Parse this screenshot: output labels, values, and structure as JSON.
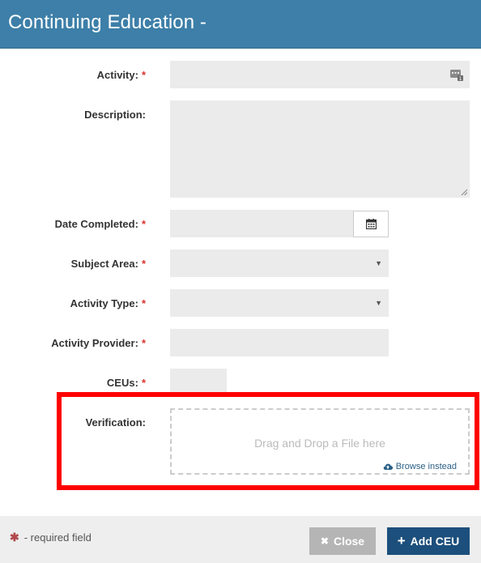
{
  "header": {
    "title": "Continuing Education -"
  },
  "form": {
    "activity": {
      "label": "Activity:",
      "required": "*",
      "value": ""
    },
    "description": {
      "label": "Description:",
      "value": ""
    },
    "date_completed": {
      "label": "Date Completed:",
      "required": "*",
      "value": ""
    },
    "subject_area": {
      "label": "Subject Area:",
      "required": "*",
      "selected": ""
    },
    "activity_type": {
      "label": "Activity Type:",
      "required": "*",
      "selected": ""
    },
    "activity_provider": {
      "label": "Activity Provider:",
      "required": "*",
      "value": ""
    },
    "ceus": {
      "label": "CEUs:",
      "required": "*",
      "value": ""
    },
    "verification": {
      "label": "Verification:",
      "drop_text": "Drag and Drop a File here",
      "browse_text": "Browse instead"
    }
  },
  "footer": {
    "required_note": "- required field",
    "required_star": "✱",
    "close_label": "Close",
    "close_icon": "✖",
    "add_label": "Add CEU",
    "add_icon": "+"
  },
  "colors": {
    "header_bg": "#3d7fa8",
    "primary_button": "#1c4f7c",
    "required": "#d9322d",
    "highlight": "#ff0000"
  }
}
